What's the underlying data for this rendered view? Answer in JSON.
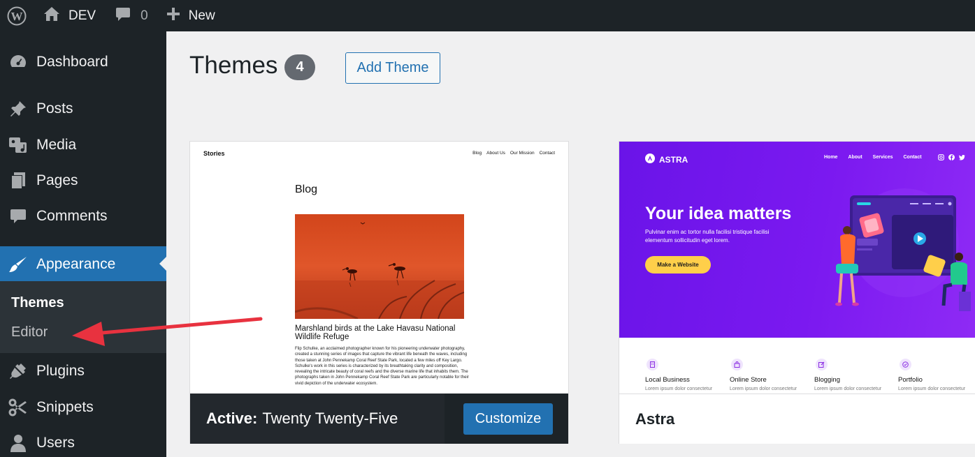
{
  "adminbar": {
    "site_name": "DEV",
    "comments_count": "0",
    "new_label": "New"
  },
  "sidebar": {
    "items": [
      {
        "label": "Dashboard",
        "icon": "dashboard-icon"
      },
      {
        "label": "Posts",
        "icon": "pin-icon"
      },
      {
        "label": "Media",
        "icon": "media-icon"
      },
      {
        "label": "Pages",
        "icon": "pages-icon"
      },
      {
        "label": "Comments",
        "icon": "comment-icon"
      },
      {
        "label": "Appearance",
        "icon": "brush-icon",
        "current": true
      },
      {
        "label": "Plugins",
        "icon": "plug-icon"
      },
      {
        "label": "Snippets",
        "icon": "scissors-icon"
      },
      {
        "label": "Users",
        "icon": "user-icon"
      }
    ],
    "submenu": [
      {
        "label": "Themes",
        "current": true
      },
      {
        "label": "Editor"
      }
    ]
  },
  "main": {
    "title": "Themes",
    "count": "4",
    "add_button": "Add Theme"
  },
  "themes": [
    {
      "preview": {
        "site_title": "Stories",
        "nav": [
          "Blog",
          "About Us",
          "Our Mission",
          "Contact"
        ],
        "page_heading": "Blog",
        "post_title": "Marshland birds at the Lake Havasu National Wildlife Refuge",
        "post_excerpt": "Flip Schulke, an acclaimed photographer known for his pioneering underwater photography, created a stunning series of images that capture the vibrant life beneath the waves, including those taken at John Pennekamp Coral Reef State Park, located a few miles off Key Largo. Schulke's work in this series is characterized by its breathtaking clarity and composition, revealing the intricate beauty of coral reefs and the diverse marine life that inhabits them. The photographs taken in John Pennekamp Coral Reef State Park are particularly notable for their vivid depiction of the underwater ecosystem."
      },
      "active_label": "Active:",
      "name": "Twenty Twenty-Five",
      "customize_label": "Customize"
    },
    {
      "preview": {
        "brand": "ASTRA",
        "nav": [
          "Home",
          "About",
          "Services",
          "Contact"
        ],
        "headline": "Your idea matters",
        "subtext": "Pulvinar enim ac tortor nulla facilisi tristique facilisi elementum sollicitudin eget lorem.",
        "cta": "Make a Website",
        "features": [
          {
            "label": "Local Business",
            "desc": "Lorem ipsum dolor consectetur"
          },
          {
            "label": "Online Store",
            "desc": "Lorem ipsum dolor consectetur"
          },
          {
            "label": "Blogging",
            "desc": "Lorem ipsum dolor consectetur"
          },
          {
            "label": "Portfolio",
            "desc": "Lorem ipsum dolor consectetur"
          }
        ]
      },
      "name": "Astra"
    }
  ],
  "colors": {
    "admin_dark": "#1d2327",
    "accent_blue": "#2271b1",
    "astra_purple": "#7b19f0",
    "astra_cta": "#ffcf4a",
    "annotation_arrow": "#e8323f"
  }
}
